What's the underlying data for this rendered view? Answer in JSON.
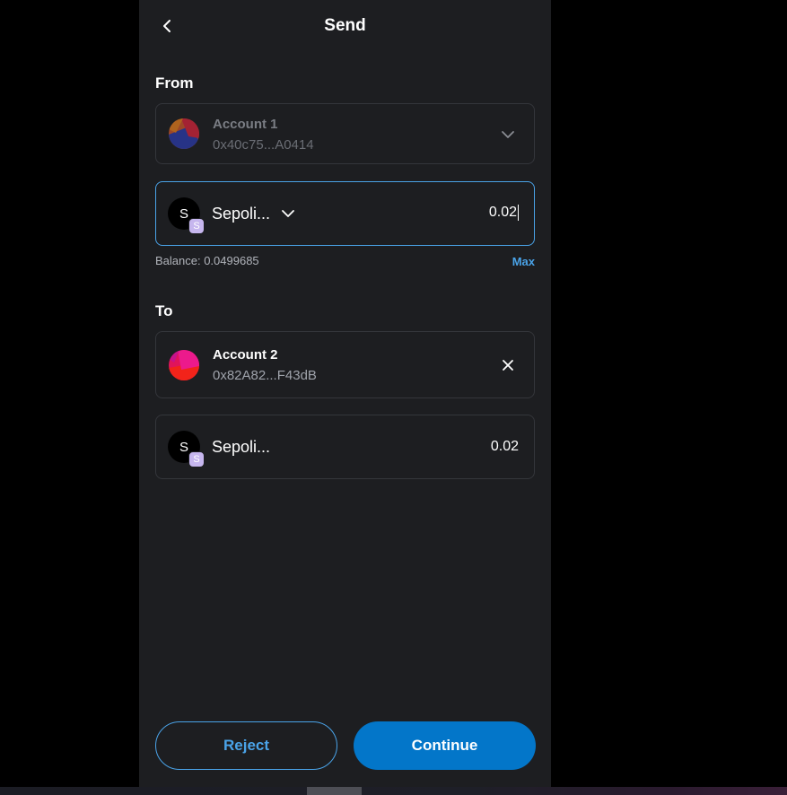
{
  "header": {
    "title": "Send",
    "back_icon": "chevron-left-icon"
  },
  "from": {
    "label": "From",
    "account": {
      "name": "Account 1",
      "address": "0x40c75...A0414"
    },
    "asset": {
      "logo_letter": "S",
      "badge_letter": "S",
      "name": "Sepoli...",
      "amount": "0.02"
    },
    "balance": "Balance: 0.0499685",
    "max_label": "Max"
  },
  "to": {
    "label": "To",
    "account": {
      "name": "Account 2",
      "address": "0x82A82...F43dB"
    },
    "asset": {
      "logo_letter": "S",
      "badge_letter": "S",
      "name": "Sepoli...",
      "amount": "0.02"
    }
  },
  "actions": {
    "reject_label": "Reject",
    "continue_label": "Continue"
  },
  "colors": {
    "panel_bg": "#1d1e21",
    "accent": "#4aa3e8",
    "primary_button": "#0376c9",
    "card_border": "#34363b"
  }
}
